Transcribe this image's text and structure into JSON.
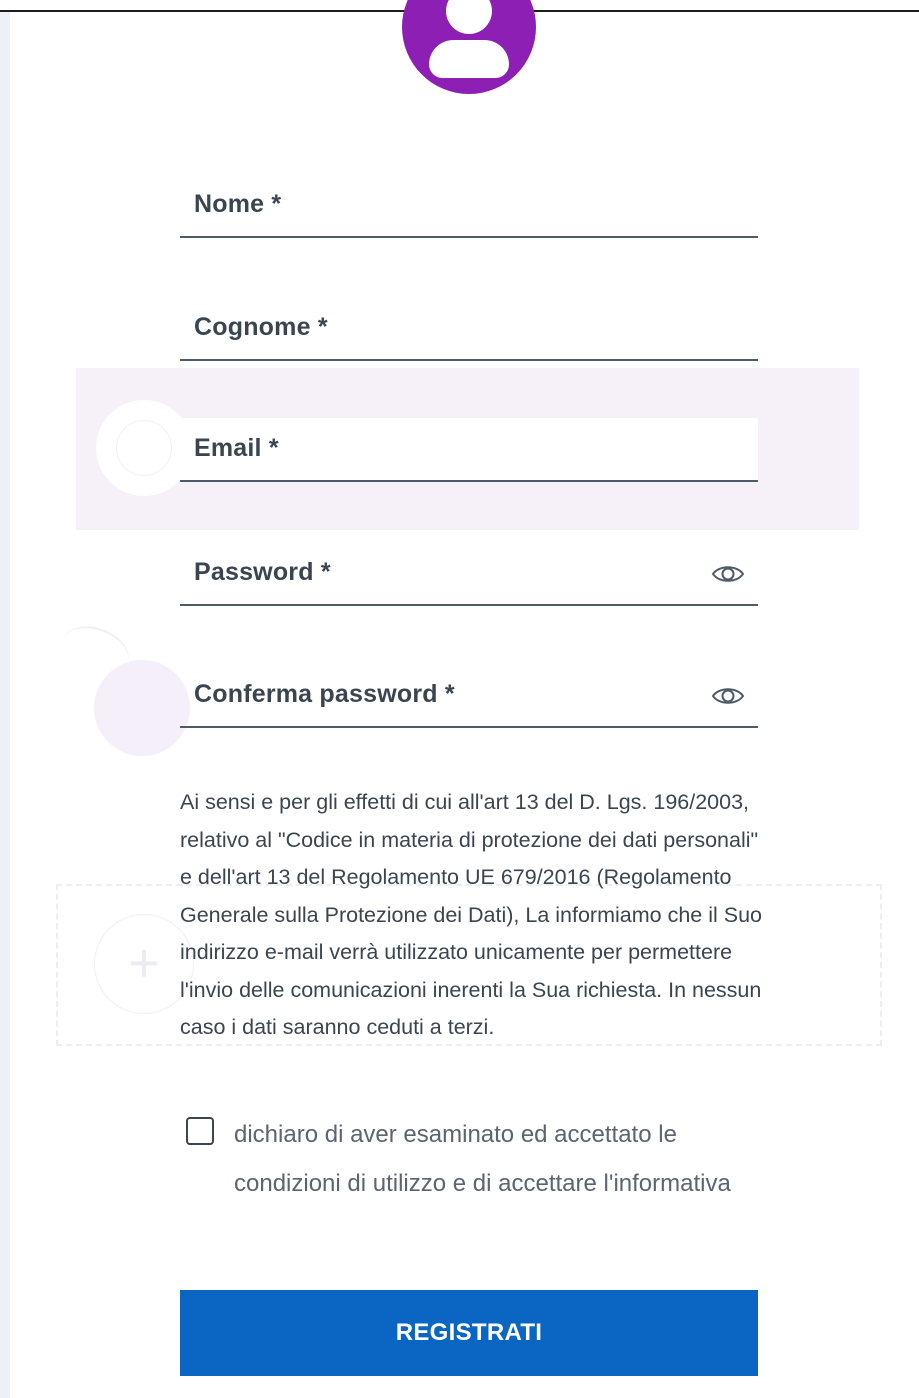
{
  "form": {
    "fields": [
      {
        "label": "Nome *"
      },
      {
        "label": "Cognome *"
      },
      {
        "label": "Email *"
      },
      {
        "label": "Password *",
        "icon": "eye-icon"
      },
      {
        "label": "Conferma password *",
        "icon": "eye-icon"
      }
    ],
    "privacy_notice": "Ai sensi e per gli effetti di cui all'art 13 del D. Lgs. 196/2003, relativo al \"Codice in materia di protezione dei dati personali\" e dell'art 13 del Regolamento UE 679/2016 (Regolamento Generale sulla Protezione dei Dati), La informiamo che il Suo indirizzo e-mail verrà utilizzato unicamente per permettere l'invio delle comunicazioni inerenti la Sua richiesta. In nessun caso i dati saranno ceduti a terzi.",
    "consent_label": "dichiaro di aver esaminato ed accettato le condizioni di utilizzo e di accettare l'informativa",
    "submit_label": "REGISTRATI"
  },
  "colors": {
    "avatar": "#8d1fb5",
    "primary_button": "#0a66c2",
    "text": "#3b4550"
  }
}
